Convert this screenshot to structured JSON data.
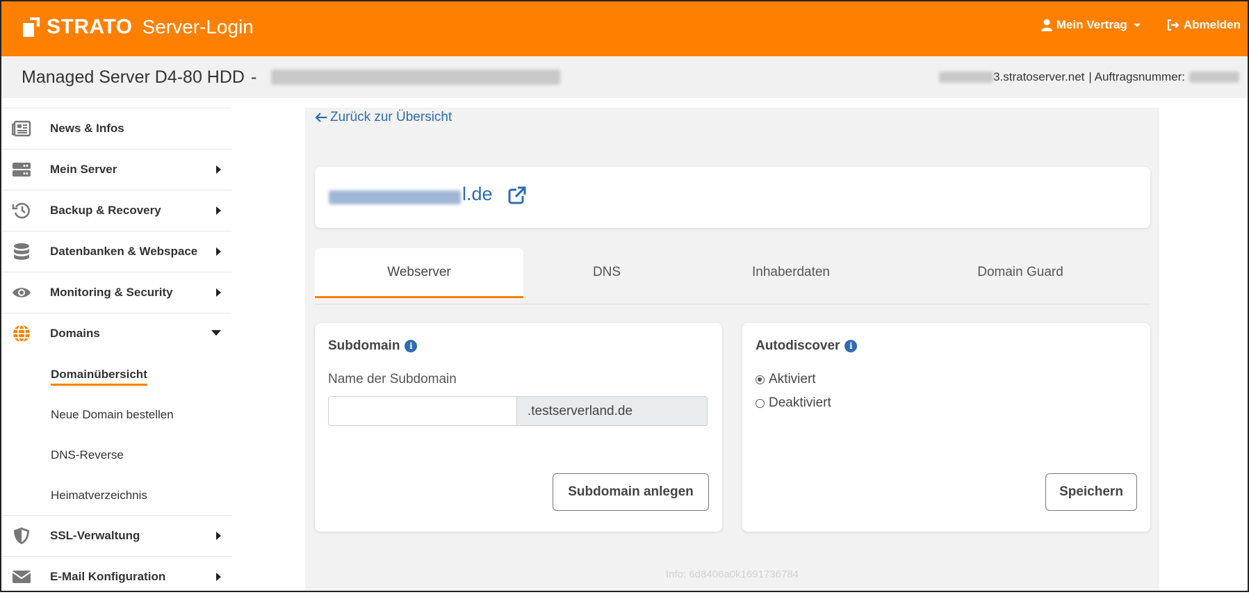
{
  "header": {
    "brand": "STRATO",
    "product": "Server-Login",
    "account_menu": "Mein Vertrag",
    "logout": "Abmelden",
    "colors": {
      "brand_orange": "#ff8000",
      "link_blue": "#2e6bb0"
    }
  },
  "subheader": {
    "title": "Managed Server D4-80 HDD",
    "separator": "-",
    "server_suffix": "3.stratoserver.net",
    "order_label": "| Auftragsnummer:"
  },
  "sidebar": {
    "items": [
      {
        "label": "News & Infos",
        "icon": "newspaper-icon"
      },
      {
        "label": "Mein Server",
        "icon": "server-icon"
      },
      {
        "label": "Backup & Recovery",
        "icon": "history-icon"
      },
      {
        "label": "Datenbanken & Webspace",
        "icon": "database-icon"
      },
      {
        "label": "Monitoring & Security",
        "icon": "eye-icon"
      },
      {
        "label": "Domains",
        "icon": "globe-icon"
      },
      {
        "label": "SSL-Verwaltung",
        "icon": "shield-icon"
      },
      {
        "label": "E-Mail Konfiguration",
        "icon": "envelope-icon"
      }
    ],
    "domain_sub_items": [
      {
        "label": "Domainübersicht"
      },
      {
        "label": "Neue Domain bestellen"
      },
      {
        "label": "DNS-Reverse"
      },
      {
        "label": "Heimatverzeichnis"
      }
    ]
  },
  "main": {
    "back_link": "Zurück zur Übersicht",
    "domain_suffix": "l.de",
    "tabs": [
      {
        "label": "Webserver"
      },
      {
        "label": "DNS"
      },
      {
        "label": "Inhaberdaten"
      },
      {
        "label": "Domain Guard"
      }
    ],
    "subdomain": {
      "title": "Subdomain",
      "field_label": "Name der Subdomain",
      "input_value": "",
      "suffix": ".testserverland.de",
      "button": "Subdomain anlegen"
    },
    "autodiscover": {
      "title": "Autodiscover",
      "options": [
        {
          "label": "Aktiviert",
          "checked": true
        },
        {
          "label": "Deaktiviert",
          "checked": false
        }
      ],
      "button": "Speichern"
    },
    "footer_info": "Info: 6d8406a0k1691736784"
  }
}
